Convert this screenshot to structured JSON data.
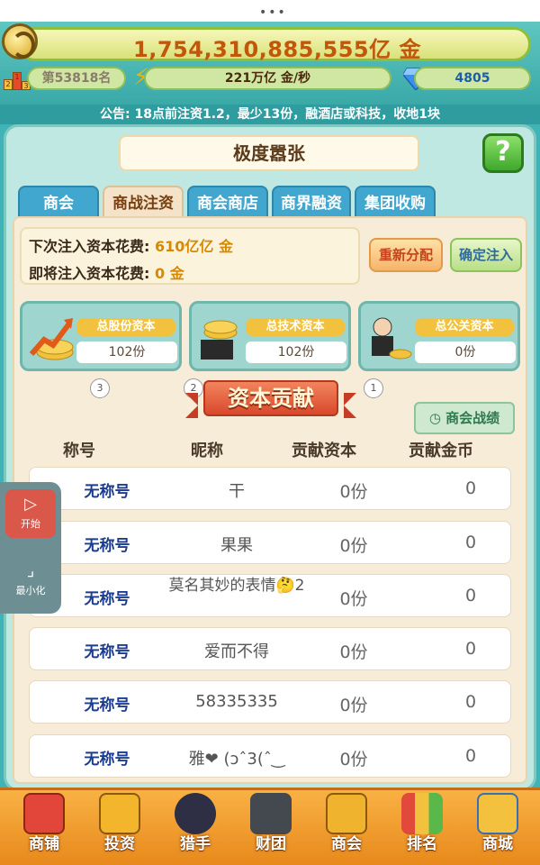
{
  "window": {
    "drag_handle": "•••"
  },
  "resources": {
    "gold_amount": "1,754,310,885,555亿 金",
    "rank": "第53818名",
    "income_rate": "221万亿 金/秒",
    "gems": "4805"
  },
  "announcement": "公告: 18点前注资1.2，最少13份，融酒店或科技，收地1块",
  "page": {
    "title": "极度嚣张",
    "help_icon": "?"
  },
  "tabs": [
    {
      "label": "商会",
      "active": false
    },
    {
      "label": "商战注资",
      "active": true
    },
    {
      "label": "商会商店",
      "active": false
    },
    {
      "label": "商界融资",
      "active": false
    },
    {
      "label": "集团收购",
      "active": false
    }
  ],
  "cost": {
    "next_label": "下次注入资本花费: ",
    "next_value": "610亿亿 金",
    "pending_label": "即将注入资本花费: ",
    "pending_value": "0 金"
  },
  "buttons": {
    "redistribute": "重新分配",
    "confirm_inject": "确定注入",
    "history": "商会战绩"
  },
  "capital_cards": [
    {
      "label": "总股份资本",
      "count": "102份",
      "rank": "3"
    },
    {
      "label": "总技术资本",
      "count": "102份",
      "rank": "2"
    },
    {
      "label": "总公关资本",
      "count": "0份",
      "rank": "1"
    }
  ],
  "section_title": "资本贡献",
  "table": {
    "headers": [
      "称号",
      "昵称",
      "贡献资本",
      "贡献金币"
    ],
    "rows": [
      {
        "title": "无称号",
        "nick": "干",
        "capital": "0份",
        "gold": "0"
      },
      {
        "title": "无称号",
        "nick": "果果",
        "capital": "0份",
        "gold": "0"
      },
      {
        "title": "无称号",
        "nick": "莫名其妙的表情🤔2",
        "capital": "0份",
        "gold": "0"
      },
      {
        "title": "无称号",
        "nick": "爱而不得",
        "capital": "0份",
        "gold": "0"
      },
      {
        "title": "无称号",
        "nick": "58335335",
        "capital": "0份",
        "gold": "0"
      },
      {
        "title": "无称号",
        "nick": "雅❤ (ɔˆ3(ˆ‿",
        "capital": "0份",
        "gold": "0"
      }
    ]
  },
  "float_widget": {
    "start_label": "开始",
    "minimize_label": "最小化"
  },
  "bottom_nav": [
    {
      "label": "商铺",
      "icon": "shop-icon",
      "color": "#e2463a"
    },
    {
      "label": "投资",
      "icon": "investment-icon",
      "color": "#f2b52c"
    },
    {
      "label": "猎手",
      "icon": "hunter-icon",
      "color": "#2e2e44"
    },
    {
      "label": "财团",
      "icon": "consortium-icon",
      "color": "#44484f"
    },
    {
      "label": "商会",
      "icon": "chamber-icon",
      "color": "#f0b32e"
    },
    {
      "label": "排名",
      "icon": "ranking-icon",
      "color": "#e14a3a"
    },
    {
      "label": "商城",
      "icon": "mall-icon",
      "color": "#f3c13d"
    }
  ]
}
